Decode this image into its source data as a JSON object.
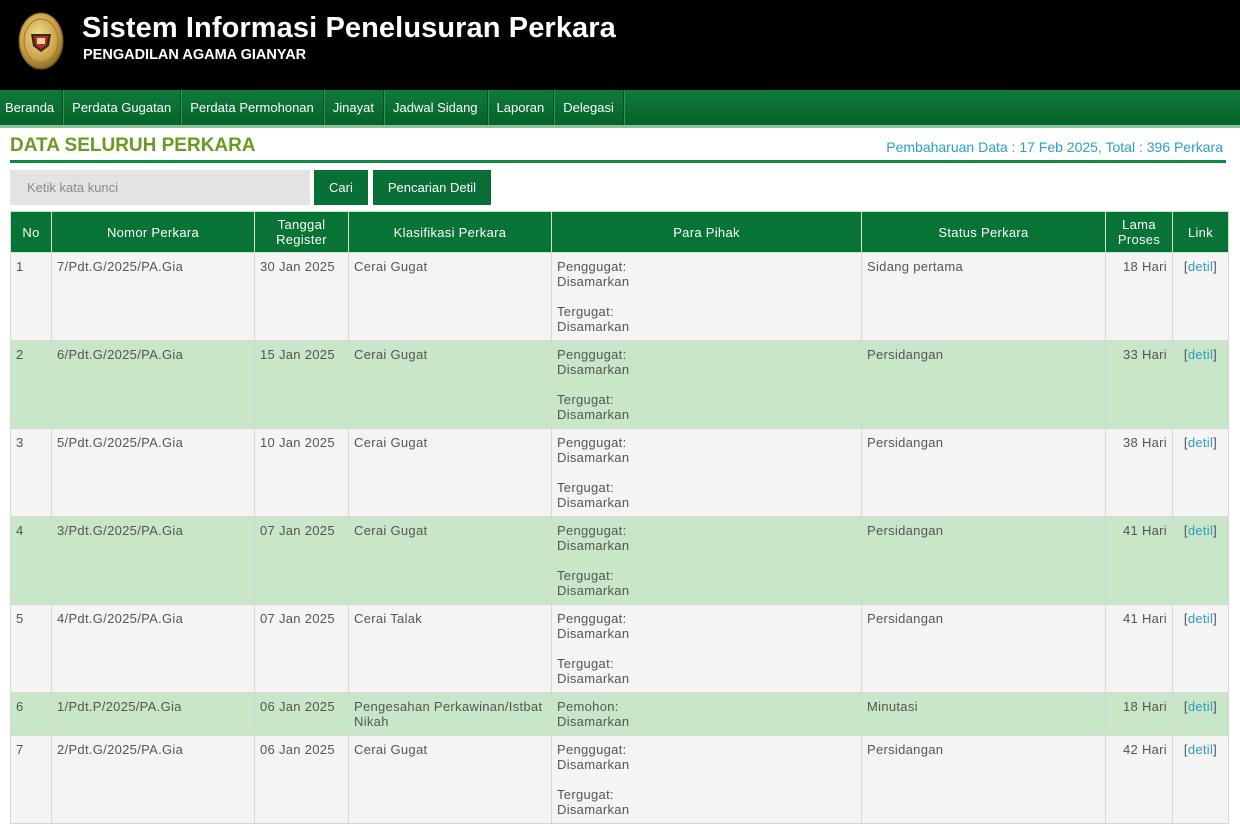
{
  "header": {
    "title": "Sistem Informasi Penelusuran Perkara",
    "subtitle": "PENGADILAN AGAMA GIANYAR"
  },
  "nav": [
    "Beranda",
    "Perdata Gugatan",
    "Perdata Permohonan",
    "Jinayat",
    "Jadwal Sidang",
    "Laporan",
    "Delegasi"
  ],
  "page": {
    "title": "DATA SELURUH PERKARA",
    "update_info": "Pembaharuan Data : 17 Feb 2025, Total : 396 Perkara"
  },
  "search": {
    "placeholder": "Ketik kata kunci",
    "button": "Cari",
    "detail_button": "Pencarian Detil"
  },
  "table": {
    "headers": {
      "no": "No",
      "nomor": "Nomor Perkara",
      "tanggal_1": "Tanggal",
      "tanggal_2": "Register",
      "klasifikasi": "Klasifikasi Perkara",
      "pihak": "Para Pihak",
      "status": "Status Perkara",
      "lama_1": "Lama",
      "lama_2": "Proses",
      "link": "Link"
    },
    "link_open": "[",
    "link_label": "detil",
    "link_close": "]",
    "rows": [
      {
        "no": "1",
        "nomor": "7/Pdt.G/2025/PA.Gia",
        "tanggal": "30 Jan 2025",
        "klasifikasi": "Cerai Gugat",
        "p1_label": "Penggugat:",
        "p1_value": "Disamarkan",
        "p2_label": "Tergugat:",
        "p2_value": "Disamarkan",
        "status": "Sidang pertama",
        "lama": "18 Hari"
      },
      {
        "no": "2",
        "nomor": "6/Pdt.G/2025/PA.Gia",
        "tanggal": "15 Jan 2025",
        "klasifikasi": "Cerai Gugat",
        "p1_label": "Penggugat:",
        "p1_value": "Disamarkan",
        "p2_label": "Tergugat:",
        "p2_value": "Disamarkan",
        "status": "Persidangan",
        "lama": "33 Hari"
      },
      {
        "no": "3",
        "nomor": "5/Pdt.G/2025/PA.Gia",
        "tanggal": "10 Jan 2025",
        "klasifikasi": "Cerai Gugat",
        "p1_label": "Penggugat:",
        "p1_value": "Disamarkan",
        "p2_label": "Tergugat:",
        "p2_value": "Disamarkan",
        "status": "Persidangan",
        "lama": "38 Hari"
      },
      {
        "no": "4",
        "nomor": "3/Pdt.G/2025/PA.Gia",
        "tanggal": "07 Jan 2025",
        "klasifikasi": "Cerai Gugat",
        "p1_label": "Penggugat:",
        "p1_value": "Disamarkan",
        "p2_label": "Tergugat:",
        "p2_value": "Disamarkan",
        "status": "Persidangan",
        "lama": "41 Hari"
      },
      {
        "no": "5",
        "nomor": "4/Pdt.G/2025/PA.Gia",
        "tanggal": "07 Jan 2025",
        "klasifikasi": "Cerai Talak",
        "p1_label": "Penggugat:",
        "p1_value": "Disamarkan",
        "p2_label": "Tergugat:",
        "p2_value": "Disamarkan",
        "status": "Persidangan",
        "lama": "41 Hari"
      },
      {
        "no": "6",
        "nomor": "1/Pdt.P/2025/PA.Gia",
        "tanggal": "06 Jan 2025",
        "klasifikasi": "Pengesahan Perkawinan/Istbat Nikah",
        "p1_label": "Pemohon:",
        "p1_value": "Disamarkan",
        "p2_label": "",
        "p2_value": "",
        "status": "Minutasi",
        "lama": "18 Hari"
      },
      {
        "no": "7",
        "nomor": "2/Pdt.G/2025/PA.Gia",
        "tanggal": "06 Jan 2025",
        "klasifikasi": "Cerai Gugat",
        "p1_label": "Penggugat:",
        "p1_value": "Disamarkan",
        "p2_label": "Tergugat:",
        "p2_value": "Disamarkan",
        "status": "Persidangan",
        "lama": "42 Hari"
      }
    ]
  }
}
